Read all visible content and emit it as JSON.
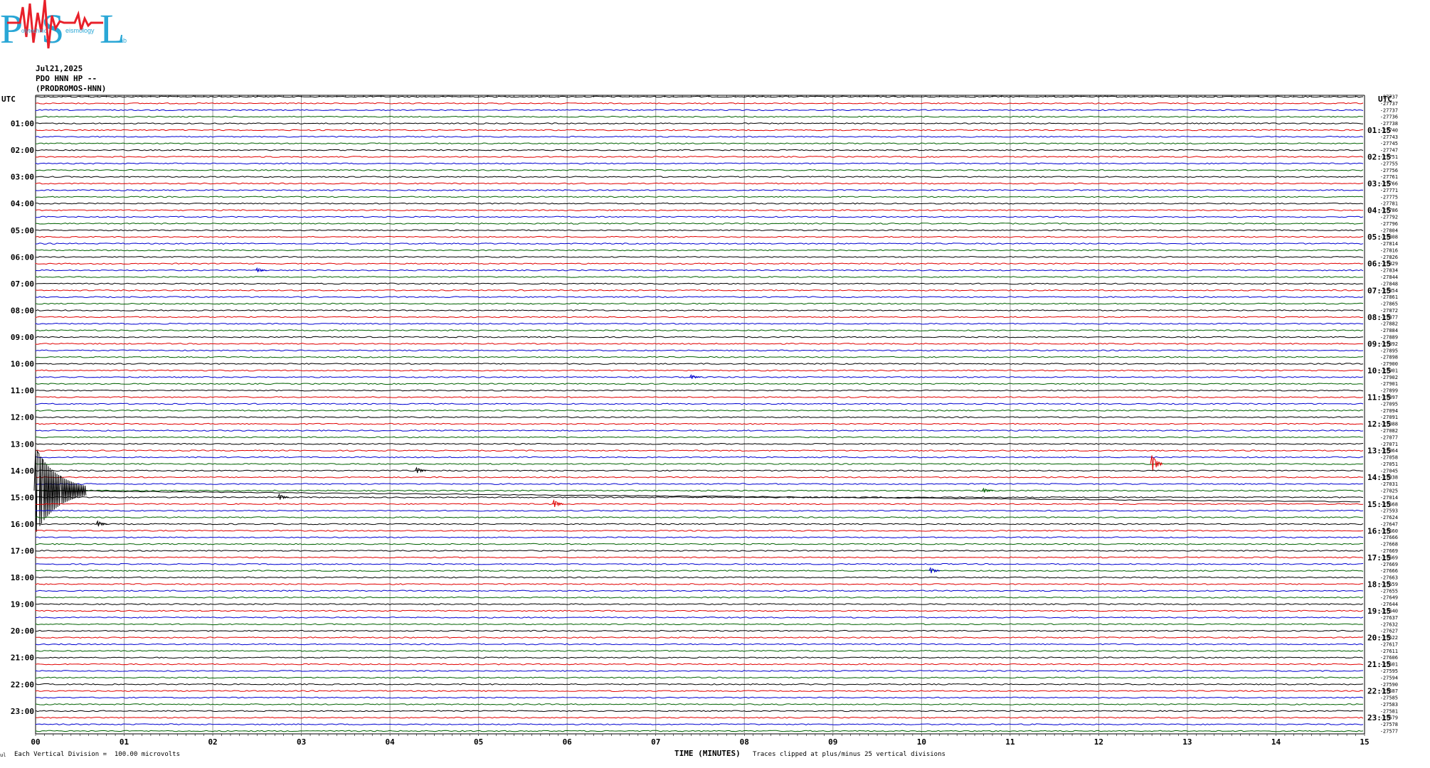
{
  "logo": {
    "letters": [
      "P",
      "S",
      "L"
    ],
    "small_words": [
      "olytechnic",
      "eismology",
      "ab"
    ]
  },
  "header": {
    "date": "Jul21,2025",
    "station": "PDO HNN HP --",
    "name": "(PRODROMOS-HNN)"
  },
  "footer": {
    "scale_note": "Each Vertical Division =  100.00 microvolts",
    "xlabel": "TIME (MINUTES)",
    "clip_note": "Traces clipped at plus/minus 25 vertical divisions"
  },
  "chart_data": {
    "type": "line",
    "xlabel": "TIME (MINUTES)",
    "x_ticks": [
      "00",
      "01",
      "02",
      "03",
      "04",
      "05",
      "06",
      "07",
      "08",
      "09",
      "10",
      "11",
      "12",
      "13",
      "14",
      "15"
    ],
    "xlim": [
      0,
      15
    ],
    "left_axis_title": "UTC",
    "right_axis_title": "UTC",
    "left_labels": [
      "01:00",
      "02:00",
      "03:00",
      "04:00",
      "05:00",
      "06:00",
      "07:00",
      "08:00",
      "09:00",
      "10:00",
      "11:00",
      "12:00",
      "13:00",
      "14:00",
      "15:00",
      "16:00",
      "17:00",
      "18:00",
      "19:00",
      "20:00",
      "21:00",
      "22:00",
      "23:00"
    ],
    "right_labels": [
      "01:15",
      "02:15",
      "03:15",
      "04:15",
      "05:15",
      "06:15",
      "07:15",
      "08:15",
      "09:15",
      "10:15",
      "11:15",
      "12:15",
      "13:15",
      "14:15",
      "15:15",
      "16:15",
      "17:15",
      "18:15",
      "19:15",
      "20:15",
      "21:15",
      "22:15",
      "23:15"
    ],
    "trace_offsets": [
      "-27737",
      "-27737",
      "-27737",
      "-27736",
      "-27738",
      "-27740",
      "-27743",
      "-27745",
      "-27747",
      "-27751",
      "-27755",
      "-27756",
      "-27761",
      "-27766",
      "-27771",
      "-27775",
      "-27781",
      "-27786",
      "-27792",
      "-27796",
      "-27804",
      "-27808",
      "-27814",
      "-27816",
      "-27826",
      "-27829",
      "-27834",
      "-27844",
      "-27848",
      "-27854",
      "-27861",
      "-27865",
      "-27872",
      "-27877",
      "-27882",
      "-27884",
      "-27889",
      "-27892",
      "-27895",
      "-27898",
      "-27900",
      "-27901",
      "-27902",
      "-27901",
      "-27899",
      "-27097",
      "-27095",
      "-27094",
      "-27091",
      "-27088",
      "-27082",
      "-27077",
      "-27071",
      "-27064",
      "-27058",
      "-27051",
      "-27045",
      "-27038",
      "-27031",
      "-27025",
      "-27014",
      "-27668",
      "-27593",
      "-27624",
      "-27647",
      "-27660",
      "-27666",
      "-27668",
      "-27669",
      "-27669",
      "-27669",
      "-27666",
      "-27663",
      "-27659",
      "-27655",
      "-27649",
      "-27644",
      "-27640",
      "-27637",
      "-27632",
      "-27627",
      "-27622",
      "-27617",
      "-27611",
      "-27606",
      "-27601",
      "-27595",
      "-27594",
      "-27590",
      "-27587",
      "-27585",
      "-27583",
      "-27581",
      "-27579",
      "-27578",
      "-27577"
    ],
    "trace_colors": [
      "#000000",
      "#e00000",
      "#0000d0",
      "#006000"
    ],
    "grid": true,
    "events": [
      {
        "trace": 55,
        "minute": 12.6,
        "amplitude": 12,
        "color": "#e00000"
      },
      {
        "trace": 56,
        "minute": 4.3,
        "amplitude": 4,
        "color": "#000000"
      },
      {
        "trace": 59,
        "minute": 0.0,
        "amplitude": 60,
        "color": "#000000"
      },
      {
        "trace": 60,
        "minute": 2.75,
        "amplitude": 4,
        "color": "#000000"
      },
      {
        "trace": 61,
        "minute": 5.85,
        "amplitude": 5,
        "color": "#e00000"
      },
      {
        "trace": 64,
        "minute": 0.7,
        "amplitude": 4,
        "color": "#000000"
      },
      {
        "trace": 71,
        "minute": 10.1,
        "amplitude": 4,
        "color": "#0000d0"
      },
      {
        "trace": 59,
        "minute": 10.7,
        "amplitude": 3,
        "color": "#006000"
      },
      {
        "trace": 26,
        "minute": 2.5,
        "amplitude": 3,
        "color": "#0000d0"
      },
      {
        "trace": 42,
        "minute": 7.4,
        "amplitude": 3,
        "color": "#0000d0"
      }
    ]
  }
}
